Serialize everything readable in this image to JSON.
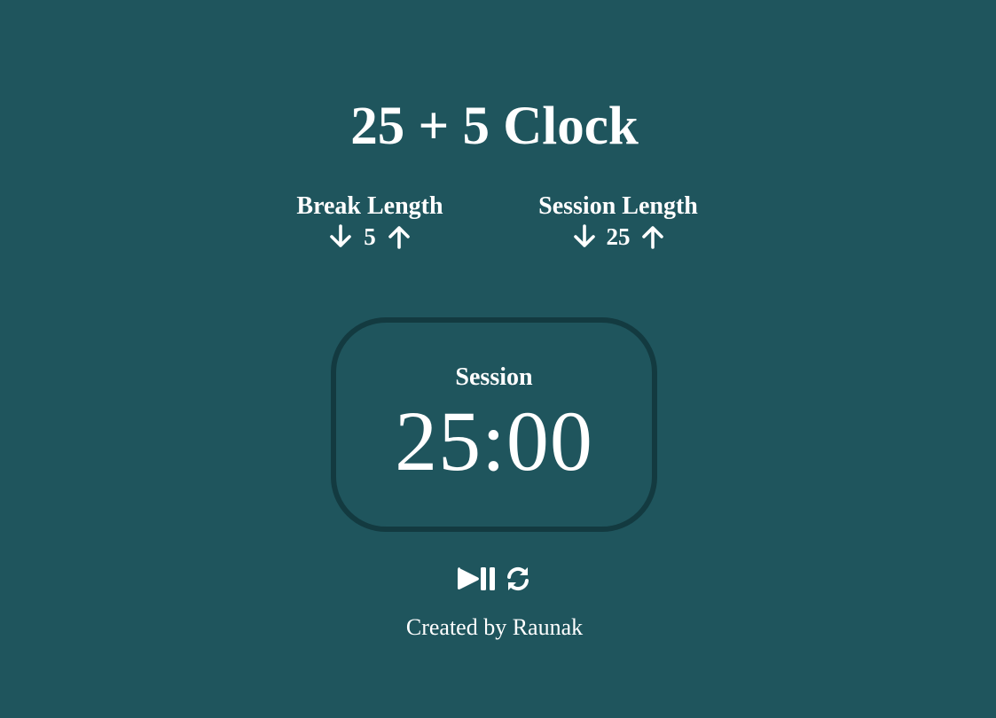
{
  "title": "25 + 5 Clock",
  "break": {
    "label": "Break Length",
    "value": "5",
    "decrement_icon": "arrow-down-icon",
    "increment_icon": "arrow-up-icon"
  },
  "session": {
    "label": "Session Length",
    "value": "25",
    "decrement_icon": "arrow-down-icon",
    "increment_icon": "arrow-up-icon"
  },
  "timer": {
    "label": "Session",
    "time_left": "25:00"
  },
  "controls": {
    "start_stop_icon": "play-pause-icon",
    "reset_icon": "refresh-icon"
  },
  "footer": {
    "text": "Created by Raunak"
  },
  "colors": {
    "background": "#1f555d",
    "timer_border": "#133a40",
    "text": "#ffffff"
  }
}
